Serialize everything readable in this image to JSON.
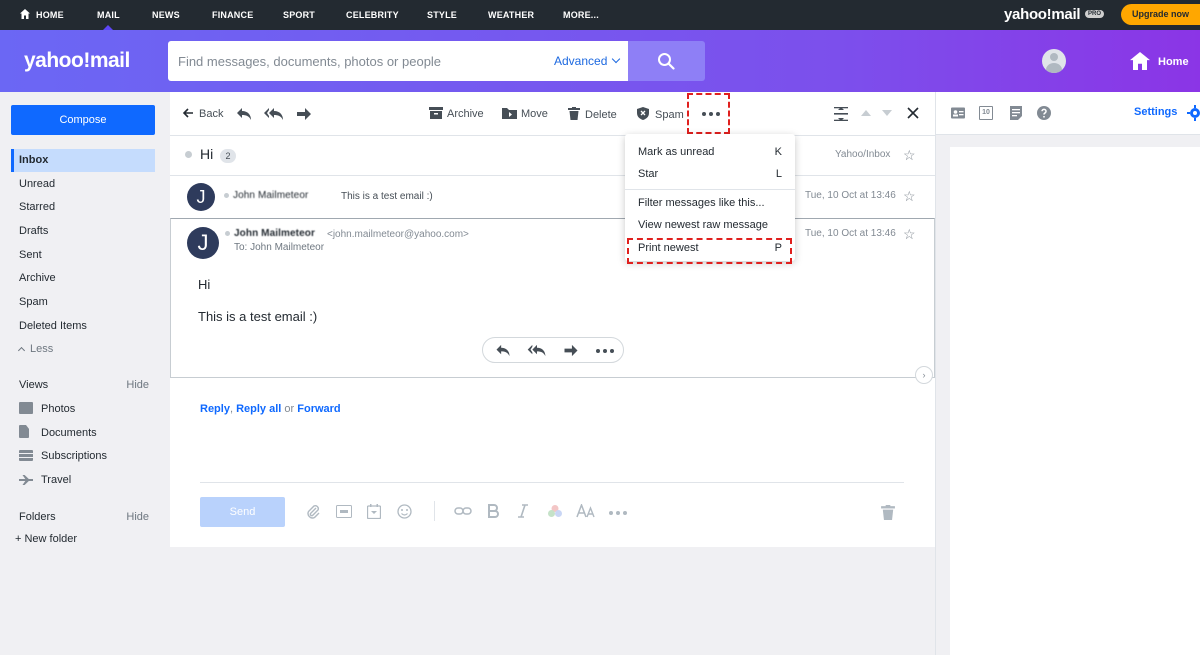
{
  "topnav": {
    "items": [
      "HOME",
      "MAIL",
      "NEWS",
      "FINANCE",
      "SPORT",
      "CELEBRITY",
      "STYLE",
      "WEATHER",
      "MORE..."
    ],
    "logo": "yahoo!mail",
    "pro_badge": "PRO",
    "upgrade_label": "Upgrade now"
  },
  "header": {
    "brand": "yahoo!mail",
    "search_placeholder": "Find messages, documents, photos or people",
    "advanced_label": "Advanced",
    "home_label": "Home"
  },
  "sidebar": {
    "compose_label": "Compose",
    "folders": [
      "Inbox",
      "Unread",
      "Starred",
      "Drafts",
      "Sent",
      "Archive",
      "Spam",
      "Deleted Items"
    ],
    "less_label": "Less",
    "views_label": "Views",
    "views_hide": "Hide",
    "views": [
      "Photos",
      "Documents",
      "Subscriptions",
      "Travel"
    ],
    "folders_label": "Folders",
    "folders_hide": "Hide",
    "new_folder_label": "+ New folder"
  },
  "toolbar": {
    "back": "Back",
    "archive": "Archive",
    "move": "Move",
    "delete": "Delete",
    "spam": "Spam"
  },
  "conversation": {
    "subject": "Hi",
    "count": "2",
    "folder": "Yahoo/Inbox",
    "collapsed_message": {
      "avatar_letter": "J",
      "sender": "John Mailmeteor",
      "snippet": "This is a test email :)",
      "date": "Tue, 10 Oct at 13:46"
    },
    "open_message": {
      "avatar_letter": "J",
      "sender": "John Mailmeteor",
      "email": "<john.mailmeteor@yahoo.com>",
      "to": "To: John Mailmeteor",
      "date": "Tue, 10 Oct at 13:46",
      "body_line1": "Hi",
      "body_line2": "This is a test email :)"
    }
  },
  "reply": {
    "reply": "Reply",
    "reply_all": "Reply all",
    "or": "or",
    "forward": "Forward",
    "send_label": "Send"
  },
  "menu": {
    "items": [
      {
        "label": "Mark as unread",
        "key": "K"
      },
      {
        "label": "Star",
        "key": "L"
      },
      {
        "label": "Filter messages like this...",
        "key": ""
      },
      {
        "label": "View newest raw message",
        "key": ""
      },
      {
        "label": "Print newest",
        "key": "P"
      }
    ]
  },
  "right_panel": {
    "calendar_day": "10",
    "settings_label": "Settings"
  },
  "colors": {
    "accent": "#0f69ff",
    "highlight": "#e0201e",
    "header_gradient_start": "#6b67f4",
    "header_gradient_end": "#8b35e6",
    "upgrade": "#ffa700"
  }
}
